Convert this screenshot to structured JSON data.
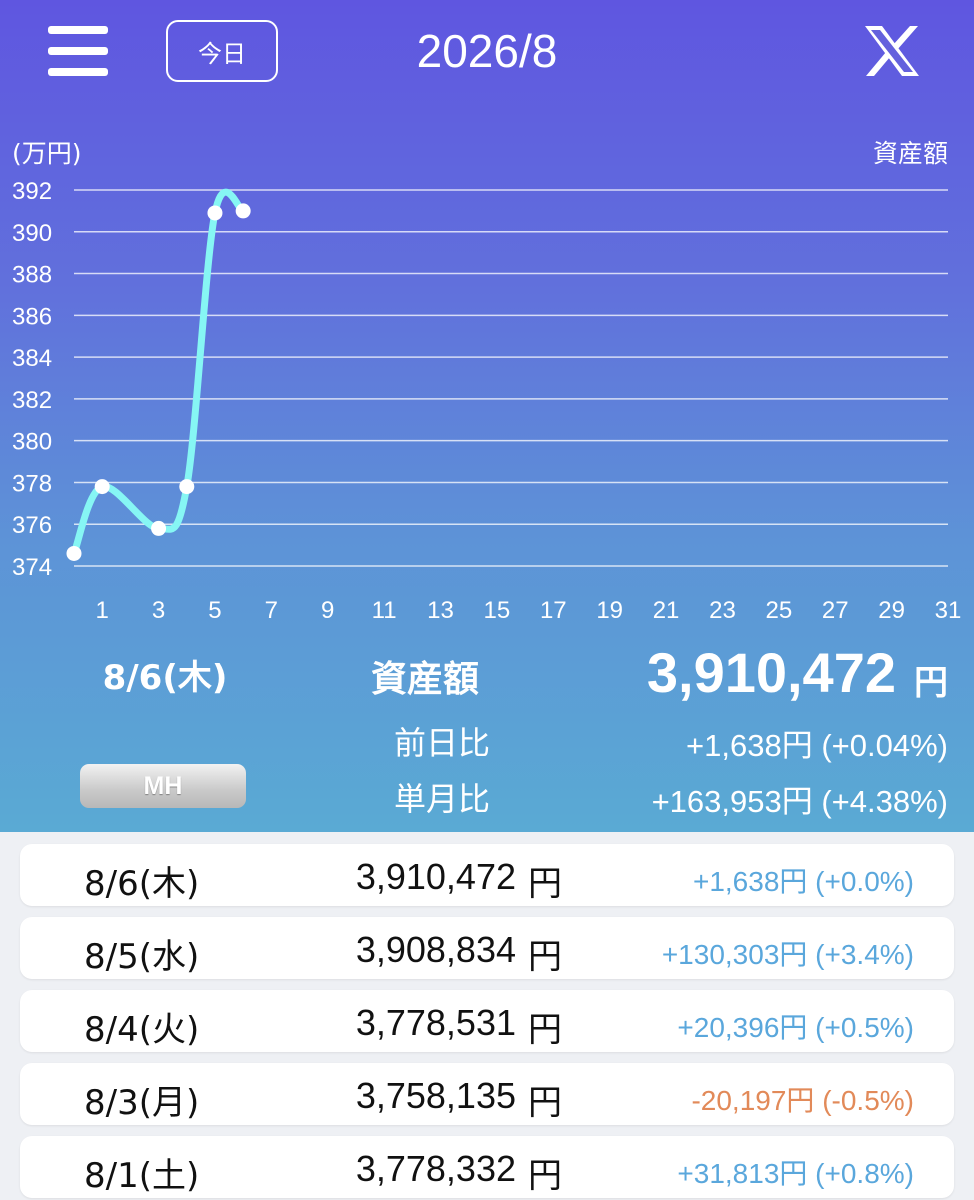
{
  "header": {
    "today_label": "今日",
    "month_title": "2026/8"
  },
  "chart_data": {
    "type": "line",
    "unit_label": "(万円)",
    "series": [
      {
        "name": "資産額",
        "x": [
          0,
          1,
          3,
          4,
          5,
          6
        ],
        "y": [
          374.6,
          377.8,
          375.8,
          377.8,
          390.9,
          391.0
        ]
      }
    ],
    "y_ticks": [
      "392",
      "390",
      "388",
      "386",
      "384",
      "382",
      "380",
      "378",
      "376",
      "374"
    ],
    "x_ticks": [
      "1",
      "3",
      "5",
      "7",
      "9",
      "11",
      "13",
      "15",
      "17",
      "19",
      "21",
      "23",
      "25",
      "27",
      "29",
      "31"
    ],
    "ylim": [
      374,
      392
    ],
    "xlim": [
      0,
      31
    ],
    "grid": true,
    "line_color": "#86f6f4"
  },
  "summary": {
    "date": "8/6(木)",
    "label": "資産額",
    "value": "3,910,472",
    "unit": "円",
    "prev_day_label": "前日比",
    "prev_day_value": "+1,638円 (+0.04%)",
    "month_label": "単月比",
    "month_value": "+163,953円 (+4.38%)",
    "mh_button": "MH"
  },
  "rows": [
    {
      "date": "8/6(木)",
      "amount": "3,910,472",
      "unit": "円",
      "change": "+1,638円 (+0.0%)",
      "sign": "pos"
    },
    {
      "date": "8/5(水)",
      "amount": "3,908,834",
      "unit": "円",
      "change": "+130,303円 (+3.4%)",
      "sign": "pos"
    },
    {
      "date": "8/4(火)",
      "amount": "3,778,531",
      "unit": "円",
      "change": "+20,396円 (+0.5%)",
      "sign": "pos"
    },
    {
      "date": "8/3(月)",
      "amount": "3,758,135",
      "unit": "円",
      "change": "-20,197円 (-0.5%)",
      "sign": "neg"
    },
    {
      "date": "8/1(土)",
      "amount": "3,778,332",
      "unit": "円",
      "change": "+31,813円 (+0.8%)",
      "sign": "pos"
    }
  ],
  "colors": {
    "positive": "#5aa7dc",
    "negative": "#e28a59"
  }
}
